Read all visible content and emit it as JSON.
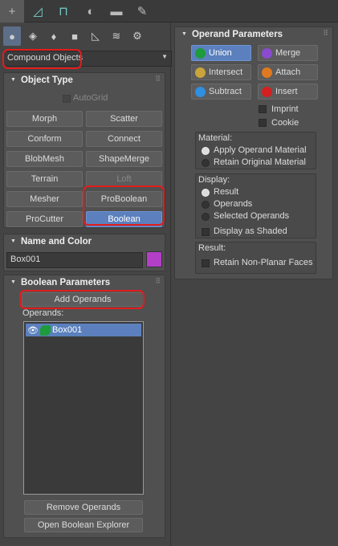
{
  "tabs": [
    {
      "icon": "plus-icon",
      "glyph": "+"
    },
    {
      "icon": "modify-curve-icon",
      "glyph": "◿"
    },
    {
      "icon": "hierarchy-icon",
      "glyph": "⊓"
    },
    {
      "icon": "motion-icon",
      "glyph": "◐"
    },
    {
      "icon": "display-icon",
      "glyph": "▬"
    },
    {
      "icon": "utilities-wrench-icon",
      "glyph": "✎"
    }
  ],
  "create_icons": [
    {
      "icon": "geometry-sphere-icon",
      "glyph": "●"
    },
    {
      "icon": "shapes-icon",
      "glyph": "◈"
    },
    {
      "icon": "lights-icon",
      "glyph": "♦"
    },
    {
      "icon": "cameras-icon",
      "glyph": "■"
    },
    {
      "icon": "helpers-icon",
      "glyph": "◺"
    },
    {
      "icon": "spacewarps-icon",
      "glyph": "≋"
    },
    {
      "icon": "systems-icon",
      "glyph": "⚙"
    }
  ],
  "category_dropdown": {
    "value": "Compound Objects"
  },
  "object_type": {
    "title": "Object Type",
    "autogrid": "AutoGrid",
    "buttons": [
      "Morph",
      "Scatter",
      "Conform",
      "Connect",
      "BlobMesh",
      "ShapeMerge",
      "Terrain",
      "Loft",
      "Mesher",
      "ProBoolean",
      "ProCutter",
      "Boolean"
    ]
  },
  "name_color": {
    "title": "Name and Color",
    "name": "Box001",
    "color": "#b33fc7"
  },
  "boolean_params": {
    "title": "Boolean Parameters",
    "add_operands": "Add Operands",
    "operands_label": "Operands:",
    "operand_item": "Box001",
    "remove_operands": "Remove Operands",
    "open_explorer": "Open Boolean Explorer"
  },
  "operand_params": {
    "title": "Operand Parameters",
    "ops": [
      {
        "label": "Union",
        "color": "#1e9b3a"
      },
      {
        "label": "Merge",
        "color": "#8a4bd0"
      },
      {
        "label": "Intersect",
        "color": "#c8a43a"
      },
      {
        "label": "Attach",
        "color": "#e07a20"
      },
      {
        "label": "Subtract",
        "color": "#2f8fe0"
      },
      {
        "label": "Insert",
        "color": "#d42020"
      }
    ],
    "imprint": "Imprint",
    "cookie": "Cookie",
    "material_label": "Material:",
    "material_opts": [
      "Apply Operand Material",
      "Retain Original Material"
    ],
    "display_label": "Display:",
    "display_opts": [
      "Result",
      "Operands",
      "Selected Operands"
    ],
    "display_shaded": "Display as Shaded",
    "result_label": "Result:",
    "retain_nonplanar": "Retain Non-Planar Faces"
  }
}
